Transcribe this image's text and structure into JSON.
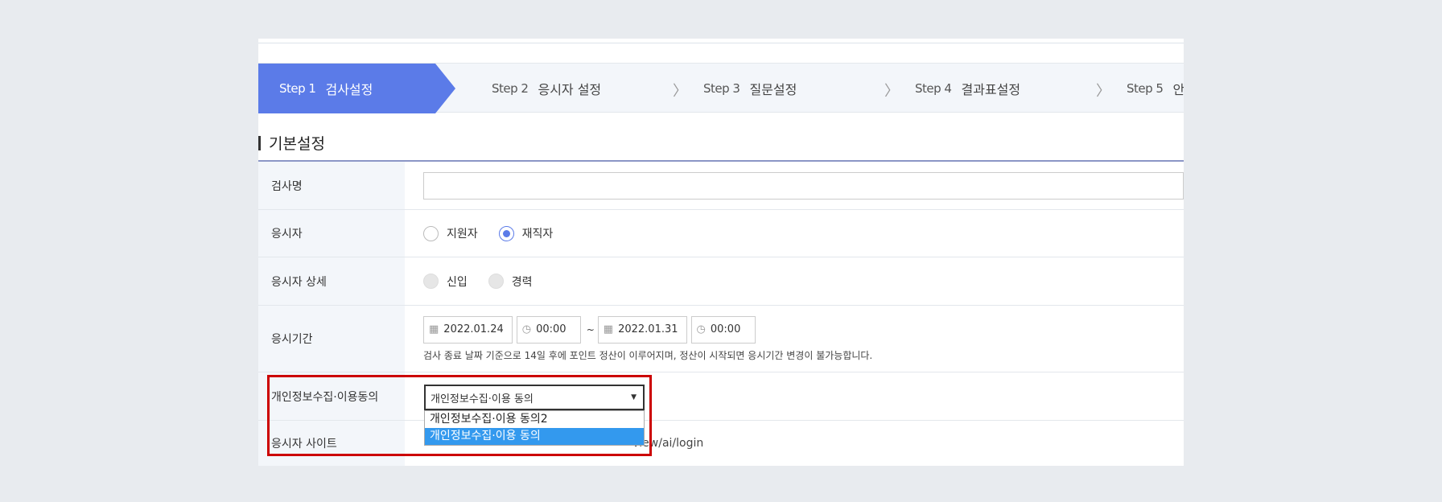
{
  "steps": [
    {
      "num": "Step 1",
      "label": "검사설정",
      "active": true
    },
    {
      "num": "Step 2",
      "label": "응시자 설정"
    },
    {
      "num": "Step 3",
      "label": "질문설정"
    },
    {
      "num": "Step 4",
      "label": "결과표설정"
    },
    {
      "num": "Step 5",
      "label": "안"
    }
  ],
  "section_title": "기본설정",
  "rows": {
    "name": {
      "label": "검사명",
      "value": ""
    },
    "examinee": {
      "label": "응시자",
      "options": [
        "지원자",
        "재직자"
      ],
      "selected": "재직자"
    },
    "detail": {
      "label": "응시자 상세",
      "options": [
        "신입",
        "경력"
      ]
    },
    "period": {
      "label": "응시기간",
      "start_date": "2022.01.24",
      "start_time": "00:00",
      "tilde": "~",
      "end_date": "2022.01.31",
      "end_time": "00:00",
      "hint": "검사 종료 날짜 기준으로 14일 후에 포인트 정산이 이루어지며, 정산이 시작되면 응시기간 변경이 불가능합니다."
    },
    "privacy": {
      "label": "개인정보수집·이용동의",
      "selected": "개인정보수집·이용 동의",
      "options": [
        "개인정보수집·이용 동의2",
        "개인정보수집·이용 동의"
      ]
    },
    "site": {
      "label": "응시자 사이트",
      "value": "view/ai/login"
    }
  },
  "colors": {
    "accent": "#5b7be8",
    "highlight": "#3399ee",
    "annotation": "#cc0000"
  }
}
